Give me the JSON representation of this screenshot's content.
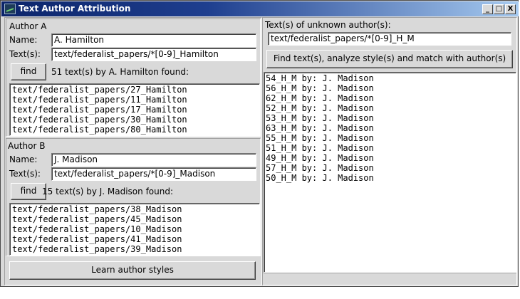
{
  "window": {
    "title": "Text Author Attribution",
    "controls": {
      "minimize": "_",
      "maximize": "□",
      "close": "X"
    }
  },
  "author_a": {
    "heading": "Author A",
    "name_label": "Name:",
    "name_value": "A. Hamilton",
    "texts_label": "Text(s):",
    "texts_value": "text/federalist_papers/*[0-9]_Hamilton",
    "find_label": "find",
    "status": "51 text(s) by A. Hamilton found:",
    "files": [
      "text/federalist_papers/27_Hamilton",
      "text/federalist_papers/11_Hamilton",
      "text/federalist_papers/17_Hamilton",
      "text/federalist_papers/30_Hamilton",
      "text/federalist_papers/80_Hamilton"
    ]
  },
  "author_b": {
    "heading": "Author B",
    "name_label": "Name:",
    "name_value": "J. Madison",
    "texts_label": "Text(s):",
    "texts_value": "text/federalist_papers/*[0-9]_Madison",
    "find_label": "find",
    "status": "15 text(s) by J. Madison found:",
    "files": [
      "text/federalist_papers/38_Madison",
      "text/federalist_papers/45_Madison",
      "text/federalist_papers/10_Madison",
      "text/federalist_papers/41_Madison",
      "text/federalist_papers/39_Madison"
    ]
  },
  "learn_button": "Learn author styles",
  "unknown": {
    "heading": "Text(s) of unknown author(s):",
    "pattern": "text/federalist_papers/*[0-9]_H_M",
    "analyze_button": "Find text(s), analyze style(s) and match with author(s)",
    "results": [
      "54_H_M by: J. Madison",
      "56_H_M by: J. Madison",
      "62_H_M by: J. Madison",
      "52_H_M by: J. Madison",
      "53_H_M by: J. Madison",
      "63_H_M by: J. Madison",
      "55_H_M by: J. Madison",
      "51_H_M by: J. Madison",
      "49_H_M by: J. Madison",
      "57_H_M by: J. Madison",
      "50_H_M by: J. Madison"
    ]
  }
}
